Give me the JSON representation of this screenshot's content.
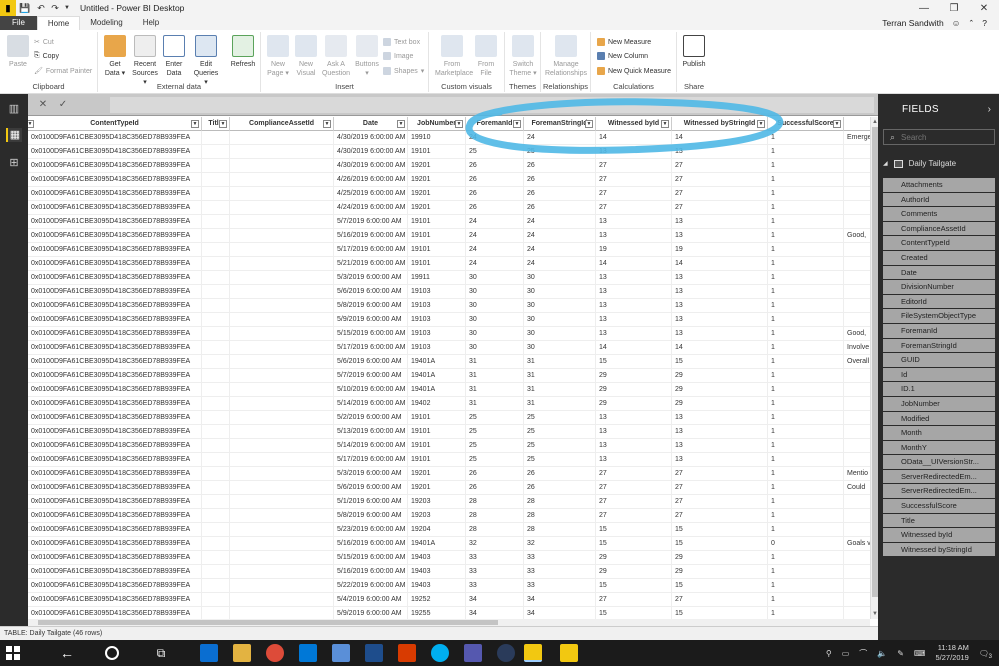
{
  "window": {
    "title": "Untitled - Power BI Desktop"
  },
  "menu": {
    "tabs": [
      "File",
      "Home",
      "Modeling",
      "Help"
    ],
    "user": "Terran Sandwith"
  },
  "ribbon": {
    "groups": {
      "clipboard": "Clipboard",
      "external": "External data",
      "insert": "Insert",
      "custom": "Custom visuals",
      "themes": "Themes",
      "relationships": "Relationships",
      "calculations": "Calculations",
      "share": "Share"
    },
    "paste": "Paste",
    "cut": "Cut",
    "copy": "Copy",
    "format_painter": "Format Painter",
    "get_data": "Get Data",
    "recent_sources": "Recent Sources",
    "enter_data": "Enter Data",
    "edit_queries": "Edit Queries",
    "refresh": "Refresh",
    "new_page": "New Page",
    "new_visual": "New Visual",
    "ask_question": "Ask A Question",
    "buttons": "Buttons",
    "text_box": "Text box",
    "image": "Image",
    "shapes": "Shapes",
    "from_marketplace": "From Marketplace",
    "from_file": "From File",
    "switch_theme": "Switch Theme",
    "manage_relationships": "Manage Relationships",
    "new_measure": "New Measure",
    "new_column": "New Column",
    "new_quick_measure": "New Quick Measure",
    "publish": "Publish"
  },
  "columns": [
    "ContentTypeId",
    "Title",
    "ComplianceAssetId",
    "Date",
    "JobNumber",
    "ForemanId",
    "ForemanStringId",
    "Witnessed byId",
    "Witnessed byStringId",
    "SuccessfulScore"
  ],
  "rows": [
    [
      "0x0100D9FA61CBE3095D418C356ED78B939FEA",
      "",
      "",
      "4/30/2019 6:00:00 AM",
      "19910",
      "24",
      "24",
      "14",
      "14",
      "1",
      "Emerge"
    ],
    [
      "0x0100D9FA61CBE3095D418C356ED78B939FEA",
      "",
      "",
      "4/30/2019 6:00:00 AM",
      "19101",
      "25",
      "25",
      "13",
      "13",
      "1",
      ""
    ],
    [
      "0x0100D9FA61CBE3095D418C356ED78B939FEA",
      "",
      "",
      "4/30/2019 6:00:00 AM",
      "19201",
      "26",
      "26",
      "27",
      "27",
      "1",
      ""
    ],
    [
      "0x0100D9FA61CBE3095D418C356ED78B939FEA",
      "",
      "",
      "4/26/2019 6:00:00 AM",
      "19201",
      "26",
      "26",
      "27",
      "27",
      "1",
      ""
    ],
    [
      "0x0100D9FA61CBE3095D418C356ED78B939FEA",
      "",
      "",
      "4/25/2019 6:00:00 AM",
      "19201",
      "26",
      "26",
      "27",
      "27",
      "1",
      ""
    ],
    [
      "0x0100D9FA61CBE3095D418C356ED78B939FEA",
      "",
      "",
      "4/24/2019 6:00:00 AM",
      "19201",
      "26",
      "26",
      "27",
      "27",
      "1",
      ""
    ],
    [
      "0x0100D9FA61CBE3095D418C356ED78B939FEA",
      "",
      "",
      "5/7/2019 6:00:00 AM",
      "19101",
      "24",
      "24",
      "13",
      "13",
      "1",
      ""
    ],
    [
      "0x0100D9FA61CBE3095D418C356ED78B939FEA",
      "",
      "",
      "5/16/2019 6:00:00 AM",
      "19101",
      "24",
      "24",
      "13",
      "13",
      "1",
      "Good, "
    ],
    [
      "0x0100D9FA61CBE3095D418C356ED78B939FEA",
      "",
      "",
      "5/17/2019 6:00:00 AM",
      "19101",
      "24",
      "24",
      "19",
      "19",
      "1",
      ""
    ],
    [
      "0x0100D9FA61CBE3095D418C356ED78B939FEA",
      "",
      "",
      "5/21/2019 6:00:00 AM",
      "19101",
      "24",
      "24",
      "14",
      "14",
      "1",
      ""
    ],
    [
      "0x0100D9FA61CBE3095D418C356ED78B939FEA",
      "",
      "",
      "5/3/2019 6:00:00 AM",
      "19911",
      "30",
      "30",
      "13",
      "13",
      "1",
      ""
    ],
    [
      "0x0100D9FA61CBE3095D418C356ED78B939FEA",
      "",
      "",
      "5/6/2019 6:00:00 AM",
      "19103",
      "30",
      "30",
      "13",
      "13",
      "1",
      ""
    ],
    [
      "0x0100D9FA61CBE3095D418C356ED78B939FEA",
      "",
      "",
      "5/8/2019 6:00:00 AM",
      "19103",
      "30",
      "30",
      "13",
      "13",
      "1",
      ""
    ],
    [
      "0x0100D9FA61CBE3095D418C356ED78B939FEA",
      "",
      "",
      "5/9/2019 6:00:00 AM",
      "19103",
      "30",
      "30",
      "13",
      "13",
      "1",
      ""
    ],
    [
      "0x0100D9FA61CBE3095D418C356ED78B939FEA",
      "",
      "",
      "5/15/2019 6:00:00 AM",
      "19103",
      "30",
      "30",
      "13",
      "13",
      "1",
      "Good, "
    ],
    [
      "0x0100D9FA61CBE3095D418C356ED78B939FEA",
      "",
      "",
      "5/17/2019 6:00:00 AM",
      "19103",
      "30",
      "30",
      "14",
      "14",
      "1",
      "Involve"
    ],
    [
      "0x0100D9FA61CBE3095D418C356ED78B939FEA",
      "",
      "",
      "5/6/2019 6:00:00 AM",
      "19401A",
      "31",
      "31",
      "15",
      "15",
      "1",
      "Overall"
    ],
    [
      "0x0100D9FA61CBE3095D418C356ED78B939FEA",
      "",
      "",
      "5/7/2019 6:00:00 AM",
      "19401A",
      "31",
      "31",
      "29",
      "29",
      "1",
      ""
    ],
    [
      "0x0100D9FA61CBE3095D418C356ED78B939FEA",
      "",
      "",
      "5/10/2019 6:00:00 AM",
      "19401A",
      "31",
      "31",
      "29",
      "29",
      "1",
      ""
    ],
    [
      "0x0100D9FA61CBE3095D418C356ED78B939FEA",
      "",
      "",
      "5/14/2019 6:00:00 AM",
      "19402",
      "31",
      "31",
      "29",
      "29",
      "1",
      ""
    ],
    [
      "0x0100D9FA61CBE3095D418C356ED78B939FEA",
      "",
      "",
      "5/2/2019 6:00:00 AM",
      "19101",
      "25",
      "25",
      "13",
      "13",
      "1",
      ""
    ],
    [
      "0x0100D9FA61CBE3095D418C356ED78B939FEA",
      "",
      "",
      "5/13/2019 6:00:00 AM",
      "19101",
      "25",
      "25",
      "13",
      "13",
      "1",
      ""
    ],
    [
      "0x0100D9FA61CBE3095D418C356ED78B939FEA",
      "",
      "",
      "5/14/2019 6:00:00 AM",
      "19101",
      "25",
      "25",
      "13",
      "13",
      "1",
      ""
    ],
    [
      "0x0100D9FA61CBE3095D418C356ED78B939FEA",
      "",
      "",
      "5/17/2019 6:00:00 AM",
      "19101",
      "25",
      "25",
      "13",
      "13",
      "1",
      ""
    ],
    [
      "0x0100D9FA61CBE3095D418C356ED78B939FEA",
      "",
      "",
      "5/3/2019 6:00:00 AM",
      "19201",
      "26",
      "26",
      "27",
      "27",
      "1",
      "Mentio"
    ],
    [
      "0x0100D9FA61CBE3095D418C356ED78B939FEA",
      "",
      "",
      "5/6/2019 6:00:00 AM",
      "19201",
      "26",
      "26",
      "27",
      "27",
      "1",
      "Could"
    ],
    [
      "0x0100D9FA61CBE3095D418C356ED78B939FEA",
      "",
      "",
      "5/1/2019 6:00:00 AM",
      "19203",
      "28",
      "28",
      "27",
      "27",
      "1",
      ""
    ],
    [
      "0x0100D9FA61CBE3095D418C356ED78B939FEA",
      "",
      "",
      "5/8/2019 6:00:00 AM",
      "19203",
      "28",
      "28",
      "27",
      "27",
      "1",
      ""
    ],
    [
      "0x0100D9FA61CBE3095D418C356ED78B939FEA",
      "",
      "",
      "5/23/2019 6:00:00 AM",
      "19204",
      "28",
      "28",
      "15",
      "15",
      "1",
      ""
    ],
    [
      "0x0100D9FA61CBE3095D418C356ED78B939FEA",
      "",
      "",
      "5/16/2019 6:00:00 AM",
      "19401A",
      "32",
      "32",
      "15",
      "15",
      "0",
      "Goals v"
    ],
    [
      "0x0100D9FA61CBE3095D418C356ED78B939FEA",
      "",
      "",
      "5/15/2019 6:00:00 AM",
      "19403",
      "33",
      "33",
      "29",
      "29",
      "1",
      ""
    ],
    [
      "0x0100D9FA61CBE3095D418C356ED78B939FEA",
      "",
      "",
      "5/16/2019 6:00:00 AM",
      "19403",
      "33",
      "33",
      "29",
      "29",
      "1",
      ""
    ],
    [
      "0x0100D9FA61CBE3095D418C356ED78B939FEA",
      "",
      "",
      "5/22/2019 6:00:00 AM",
      "19403",
      "33",
      "33",
      "15",
      "15",
      "1",
      ""
    ],
    [
      "0x0100D9FA61CBE3095D418C356ED78B939FEA",
      "",
      "",
      "5/4/2019 6:00:00 AM",
      "19252",
      "34",
      "34",
      "27",
      "27",
      "1",
      ""
    ],
    [
      "0x0100D9FA61CBE3095D418C356ED78B939FEA",
      "",
      "",
      "5/9/2019 6:00:00 AM",
      "19255",
      "34",
      "34",
      "15",
      "15",
      "1",
      ""
    ]
  ],
  "fields_panel": {
    "title": "FIELDS",
    "search_placeholder": "Search",
    "table_name": "Daily Tailgate",
    "fields": [
      "Attachments",
      "AuthorId",
      "Comments",
      "ComplianceAssetId",
      "ContentTypeId",
      "Created",
      "Date",
      "DivisionNumber",
      "EditorId",
      "FileSystemObjectType",
      "ForemanId",
      "ForemanStringId",
      "GUID",
      "Id",
      "ID.1",
      "JobNumber",
      "Modified",
      "Month",
      "MonthY",
      "OData__UIVersionStr...",
      "ServerRedirectedEm...",
      "ServerRedirectedEm...",
      "SuccessfulScore",
      "Title",
      "Witnessed byId",
      "Witnessed byStringId"
    ]
  },
  "status": {
    "text": "TABLE: Daily Tailgate (46 rows)"
  },
  "clock": {
    "time": "11:18 AM",
    "date": "5/27/2019",
    "notifications": "3"
  },
  "colors": {
    "accent_yellow": "#f2c811",
    "annotation_blue": "#4fb8e6",
    "field_bg": "#a6a6a6",
    "panel_bg": "#2b2b2b"
  }
}
